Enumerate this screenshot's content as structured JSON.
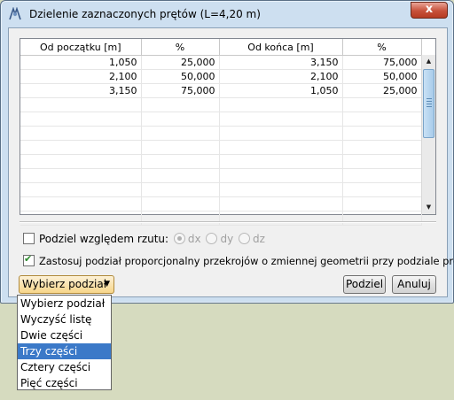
{
  "window": {
    "title": "Dzielenie zaznaczonych prętów (L=4,20 m)",
    "close_label": "x"
  },
  "table": {
    "columns": [
      "Od początku [m]",
      "%",
      "Od końca [m]",
      "%"
    ],
    "rows": [
      [
        "1,050",
        "25,000",
        "3,150",
        "75,000"
      ],
      [
        "2,100",
        "50,000",
        "2,100",
        "50,000"
      ],
      [
        "3,150",
        "75,000",
        "1,050",
        "25,000"
      ]
    ]
  },
  "options": {
    "projection_label": "Podziel względem rzutu:",
    "projection_checked": false,
    "radios": [
      {
        "label": "dx",
        "checked": true
      },
      {
        "label": "dy",
        "checked": false
      },
      {
        "label": "dz",
        "checked": false
      }
    ],
    "proportional_label": "Zastosuj podział proporcjonalny przekrojów o zmiennej geometrii przy podziale pręta",
    "proportional_checked": true
  },
  "combo": {
    "value": "Wybierz podział"
  },
  "buttons": {
    "split": "Podziel",
    "cancel": "Anuluj"
  },
  "dropdown": {
    "items": [
      "Wybierz podział",
      "Wyczyść listę",
      "Dwie części",
      "Trzy części",
      "Cztery części",
      "Pięć części"
    ],
    "selected_index": 3
  }
}
